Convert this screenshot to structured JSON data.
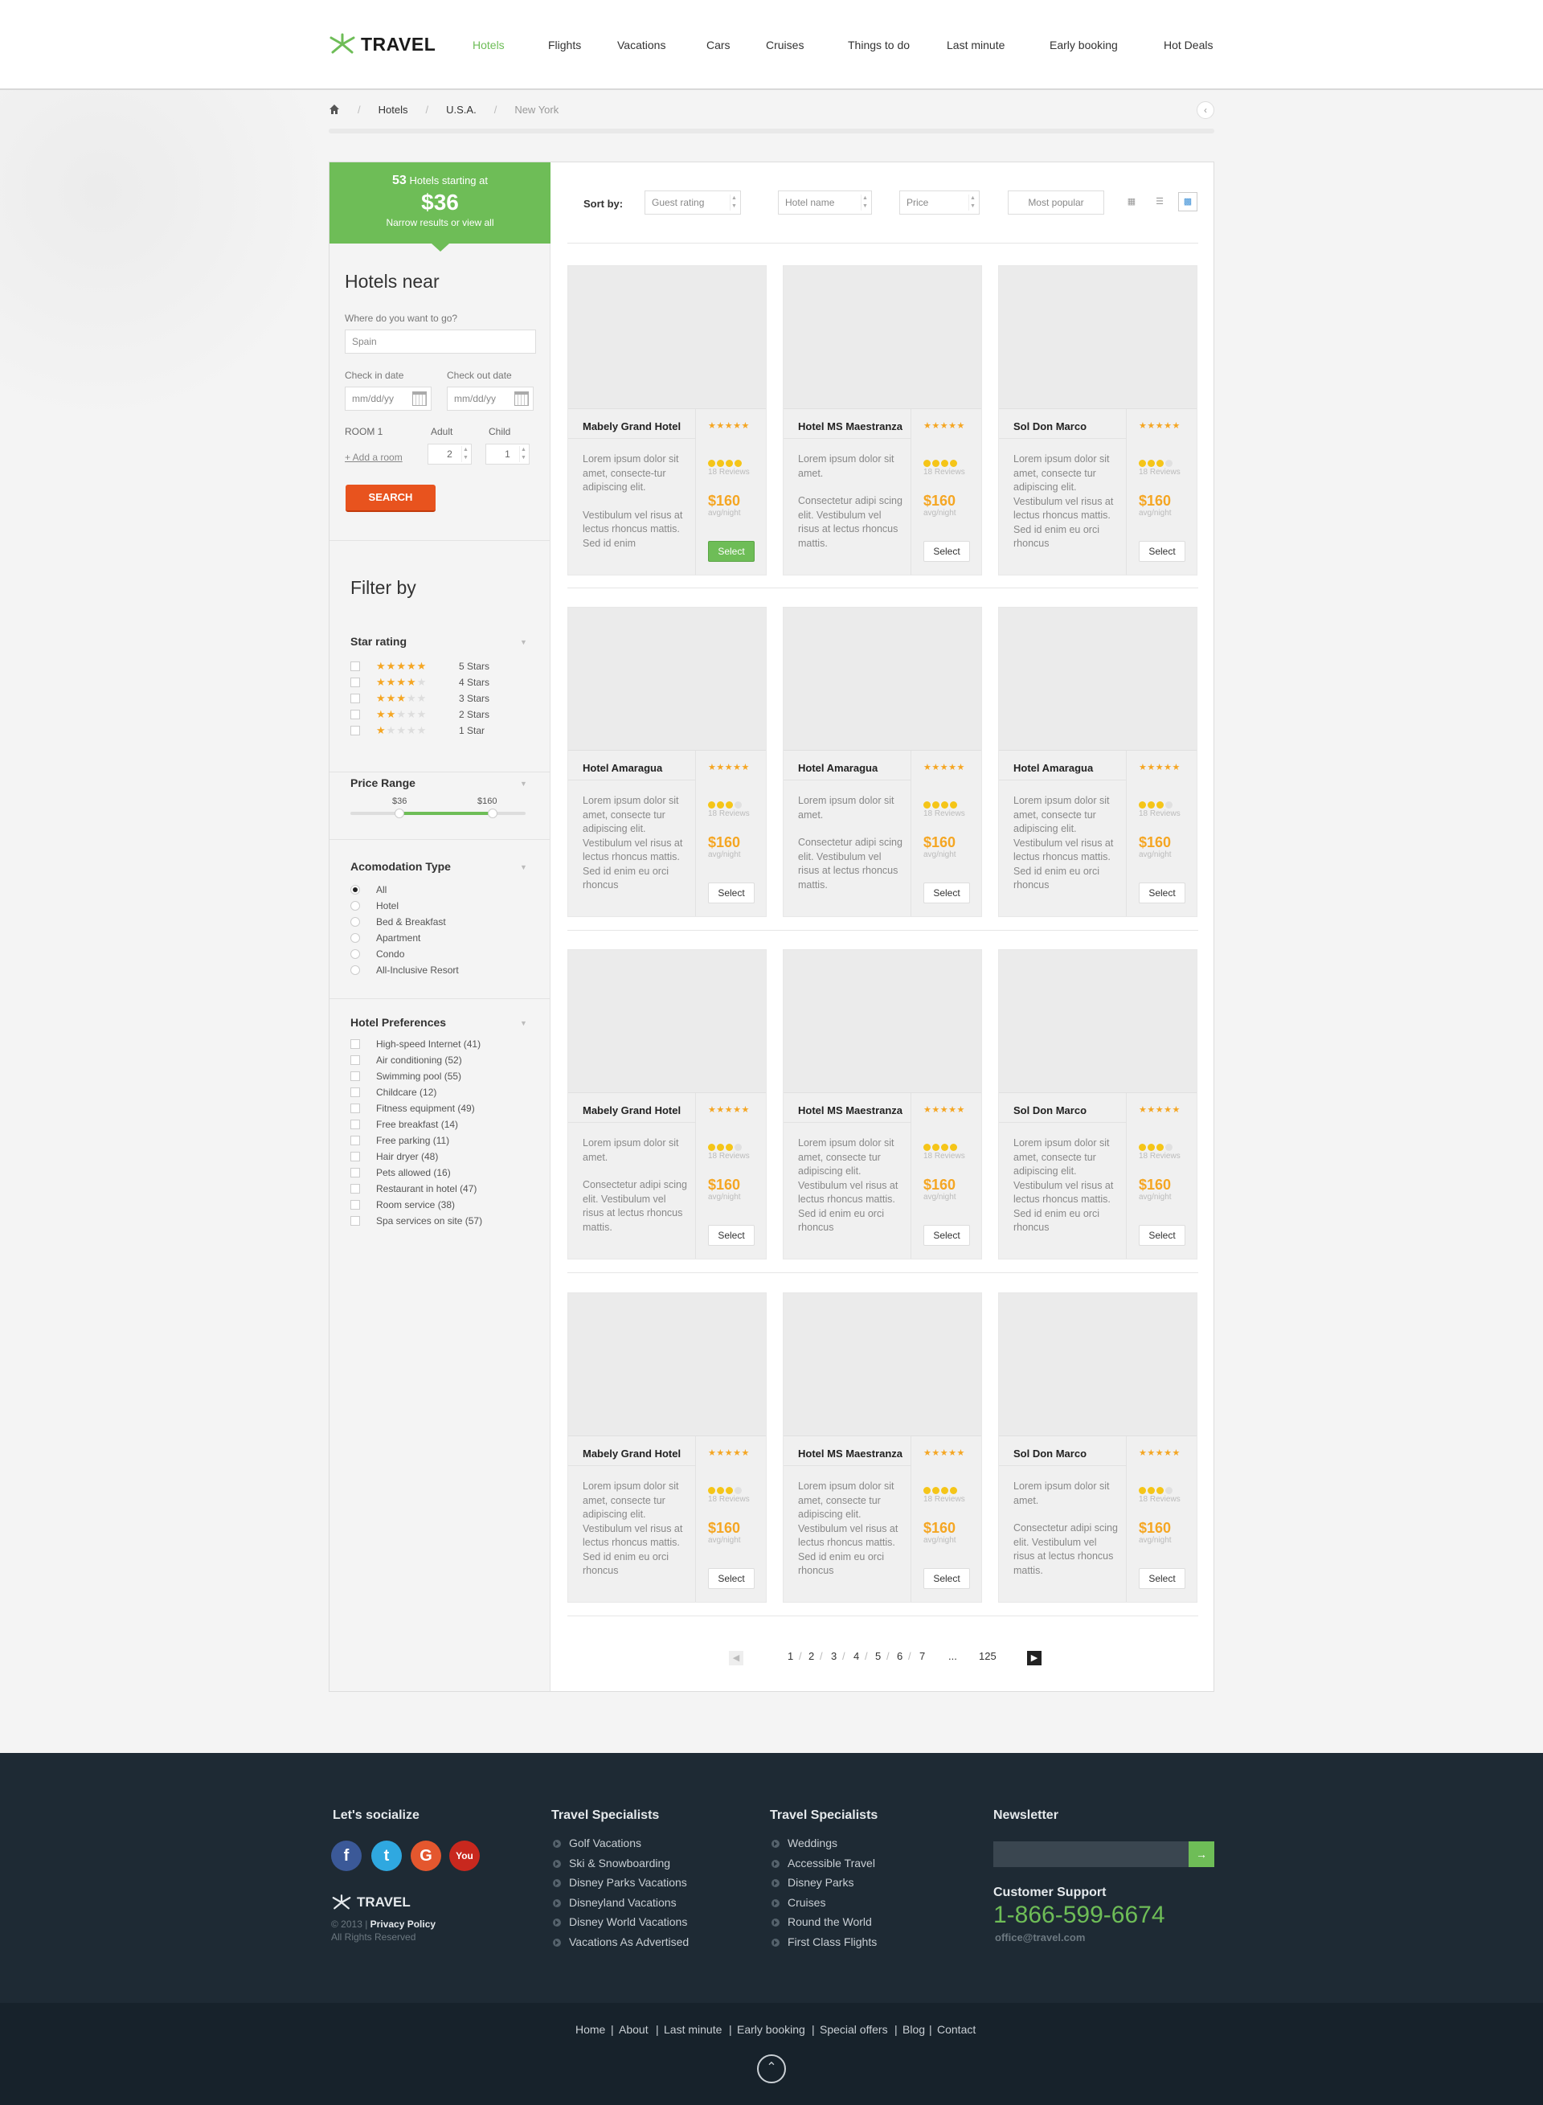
{
  "header": {
    "logo_text": "TRAVEL",
    "nav": [
      {
        "label": "Hotels",
        "active": true
      },
      {
        "label": "Flights"
      },
      {
        "label": "Vacations"
      },
      {
        "label": "Cars"
      },
      {
        "label": "Cruises"
      },
      {
        "label": "Things to do"
      },
      {
        "label": "Last minute"
      },
      {
        "label": "Early booking"
      },
      {
        "label": "Hot Deals"
      }
    ]
  },
  "breadcrumb": [
    "Hotels",
    "U.S.A.",
    "New York"
  ],
  "summary": {
    "count": "53",
    "line1_suffix": "Hotels starting at",
    "price": "$36",
    "line3": "Narrow results or view all"
  },
  "search": {
    "title": "Hotels near",
    "where_label": "Where do you want to go?",
    "where_value": "Spain",
    "checkin_label": "Check in date",
    "checkin_placeholder": "mm/dd/yy",
    "checkout_label": "Check out date",
    "checkout_placeholder": "mm/dd/yy",
    "room_label": "ROOM 1",
    "adult_label": "Adult",
    "child_label": "Child",
    "add_room": "+ Add a room",
    "adult_value": "2",
    "child_value": "1",
    "button": "SEARCH"
  },
  "filters": {
    "title": "Filter by",
    "star_rating": {
      "heading": "Star rating",
      "options": [
        {
          "label": "5 Stars",
          "stars": 5
        },
        {
          "label": "4 Stars",
          "stars": 4
        },
        {
          "label": "3 Stars",
          "stars": 3
        },
        {
          "label": "2 Stars",
          "stars": 2
        },
        {
          "label": "1 Star",
          "stars": 1
        }
      ]
    },
    "price_range": {
      "heading": "Price Range",
      "min": "$36",
      "max": "$160",
      "low_fraction": 0.28,
      "high_fraction": 0.81
    },
    "accommodation": {
      "heading": "Acomodation Type",
      "options": [
        "All",
        "Hotel",
        "Bed & Breakfast",
        "Apartment",
        "Condo",
        "All-Inclusive Resort"
      ],
      "selected": "All"
    },
    "preferences": {
      "heading": "Hotel Preferences",
      "options": [
        "High-speed Internet (41)",
        "Air conditioning (52)",
        "Swimming pool (55)",
        "Childcare (12)",
        "Fitness equipment (49)",
        "Free breakfast (14)",
        "Free parking (11)",
        "Hair dryer (48)",
        "Pets allowed (16)",
        "Restaurant in hotel (47)",
        "Room service (38)",
        "Spa services on site (57)"
      ]
    }
  },
  "sort": {
    "label": "Sort by:",
    "options": [
      "Guest rating",
      "Hotel name",
      "Price",
      "Most popular"
    ]
  },
  "hotels": [
    {
      "name": "Mabely Grand Hotel",
      "desc": [
        "Lorem ipsum dolor sit amet, consecte-tur adipiscing elit.",
        "Vestibulum vel risus at lectus rhoncus mattis. Sed id enim"
      ],
      "rating": 4,
      "reviews": "18 Reviews",
      "price": "$160",
      "per": "avg/night",
      "select": "Select",
      "active": true
    },
    {
      "name": "Hotel MS Maestranza",
      "desc": [
        "Lorem ipsum dolor sit amet.",
        "Consectetur adipi scing elit. Vestibulum vel risus at lectus rhoncus mattis."
      ],
      "rating": 4,
      "reviews": "18 Reviews",
      "price": "$160",
      "per": "avg/night",
      "select": "Select"
    },
    {
      "name": "Sol Don Marco",
      "desc": [
        "Lorem ipsum dolor sit amet, consecte tur adipiscing elit. Vestibulum vel risus at lectus rhoncus mattis. Sed id enim eu orci rhoncus"
      ],
      "rating": 3,
      "reviews": "18 Reviews",
      "price": "$160",
      "per": "avg/night",
      "select": "Select"
    },
    {
      "name": "Hotel Amaragua",
      "desc": [
        "Lorem ipsum dolor sit amet, consecte tur adipiscing elit. Vestibulum vel risus at lectus rhoncus mattis. Sed id enim eu orci rhoncus"
      ],
      "rating": 3,
      "reviews": "18 Reviews",
      "price": "$160",
      "per": "avg/night",
      "select": "Select"
    },
    {
      "name": "Hotel Amaragua",
      "desc": [
        "Lorem ipsum dolor sit amet.",
        "Consectetur adipi scing elit. Vestibulum vel risus at lectus rhoncus mattis."
      ],
      "rating": 4,
      "reviews": "18 Reviews",
      "price": "$160",
      "per": "avg/night",
      "select": "Select"
    },
    {
      "name": "Hotel Amaragua",
      "desc": [
        "Lorem ipsum dolor sit amet, consecte tur adipiscing elit. Vestibulum vel risus at lectus rhoncus mattis. Sed id enim eu orci rhoncus"
      ],
      "rating": 3,
      "reviews": "18 Reviews",
      "price": "$160",
      "per": "avg/night",
      "select": "Select"
    },
    {
      "name": "Mabely Grand Hotel",
      "desc": [
        "Lorem ipsum dolor sit amet.",
        "Consectetur adipi scing elit. Vestibulum vel risus at lectus rhoncus mattis."
      ],
      "rating": 3,
      "reviews": "18 Reviews",
      "price": "$160",
      "per": "avg/night",
      "select": "Select"
    },
    {
      "name": "Hotel MS Maestranza",
      "desc": [
        "Lorem ipsum dolor sit amet, consecte tur adipiscing elit. Vestibulum vel risus at lectus rhoncus mattis. Sed id enim eu orci rhoncus"
      ],
      "rating": 4,
      "reviews": "18 Reviews",
      "price": "$160",
      "per": "avg/night",
      "select": "Select"
    },
    {
      "name": "Sol Don Marco",
      "desc": [
        "Lorem ipsum dolor sit amet, consecte tur adipiscing elit. Vestibulum vel risus at lectus rhoncus mattis. Sed id enim eu orci rhoncus"
      ],
      "rating": 3,
      "reviews": "18 Reviews",
      "price": "$160",
      "per": "avg/night",
      "select": "Select"
    },
    {
      "name": "Mabely Grand Hotel",
      "desc": [
        "Lorem ipsum dolor sit amet, consecte tur adipiscing elit. Vestibulum vel risus at lectus rhoncus mattis. Sed id enim eu orci rhoncus"
      ],
      "rating": 3,
      "reviews": "18 Reviews",
      "price": "$160",
      "per": "avg/night",
      "select": "Select"
    },
    {
      "name": "Hotel MS Maestranza",
      "desc": [
        "Lorem ipsum dolor sit amet, consecte tur adipiscing elit. Vestibulum vel risus at lectus rhoncus mattis. Sed id enim eu orci rhoncus"
      ],
      "rating": 4,
      "reviews": "18 Reviews",
      "price": "$160",
      "per": "avg/night",
      "select": "Select"
    },
    {
      "name": "Sol Don Marco",
      "desc": [
        "Lorem ipsum dolor sit amet.",
        "Consectetur adipi scing elit. Vestibulum vel risus at lectus rhoncus mattis."
      ],
      "rating": 3,
      "reviews": "18 Reviews",
      "price": "$160",
      "per": "avg/night",
      "select": "Select"
    }
  ],
  "pagination": {
    "pages": [
      "1",
      "2",
      "3",
      "4",
      "5",
      "6",
      "7",
      "...",
      "125"
    ]
  },
  "footer": {
    "socialize": "Let's socialize",
    "logo_text": "TRAVEL",
    "copyright": "© 2013",
    "privacy": "Privacy Policy",
    "rights": "All Rights Reserved",
    "col1": {
      "heading": "Travel Specialists",
      "links": [
        "Golf Vacations",
        "Ski & Snowboarding",
        "Disney Parks Vacations",
        "Disneyland Vacations",
        "Disney World Vacations",
        "Vacations As Advertised"
      ]
    },
    "col2": {
      "heading": "Travel Specialists",
      "links": [
        "Weddings",
        "Accessible Travel",
        "Disney Parks",
        "Cruises",
        "Round the World",
        "First Class Flights"
      ]
    },
    "newsletter": "Newsletter",
    "support": "Customer Support",
    "phone": "1-866-599-6674",
    "email": "office@travel.com",
    "bottom_links": [
      "Home",
      "About",
      "Last minute",
      "Early booking",
      "Special offers",
      "Blog",
      "Contact"
    ]
  }
}
